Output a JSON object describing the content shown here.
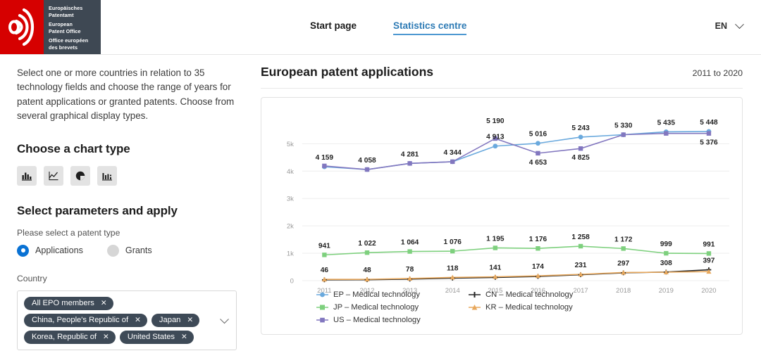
{
  "header": {
    "logo": {
      "lines": [
        "Europäisches\nPatentamt",
        "European\nPatent Office",
        "Office européen\ndes brevets"
      ],
      "line1a": "Europäisches",
      "line1b": "Patentamt",
      "line2a": "European",
      "line2b": "Patent Office",
      "line3a": "Office européen",
      "line3b": "des brevets"
    },
    "nav": [
      {
        "label": "Start page",
        "active": false
      },
      {
        "label": "Statistics centre",
        "active": true
      }
    ],
    "language": "EN"
  },
  "sidebar": {
    "intro": "Select one or more countries in relation to 35 technology fields and choose the range of years for patent applications or granted patents. Choose from several graphical display types.",
    "chart_type_heading": "Choose a chart type",
    "chart_types": [
      {
        "name": "bar-chart-icon",
        "label": "Bar chart"
      },
      {
        "name": "line-chart-icon",
        "label": "Line chart"
      },
      {
        "name": "pie-chart-icon",
        "label": "Pie chart"
      },
      {
        "name": "column-chart-icon",
        "label": "Column chart"
      }
    ],
    "parameters_heading": "Select parameters and apply",
    "patent_type_label": "Please select a patent type",
    "patent_types": [
      {
        "label": "Applications",
        "selected": true
      },
      {
        "label": "Grants",
        "selected": false
      }
    ],
    "country_label": "Country",
    "country_tags": [
      "All EPO members",
      "China, People's Republic of",
      "Japan",
      "Korea, Republic of",
      "United States"
    ],
    "remove_icon": "✕"
  },
  "chart_header": {
    "title": "European patent applications",
    "range": "2011 to 2020"
  },
  "chart_data": {
    "type": "line",
    "title": "European patent applications",
    "subtitle": "2011 to 2020",
    "xlabel": "",
    "ylabel": "",
    "x": [
      "2011",
      "2012",
      "2013",
      "2014",
      "2015",
      "2016",
      "2017",
      "2018",
      "2019",
      "2020"
    ],
    "categories": [
      "2011",
      "2012",
      "2013",
      "2014",
      "2015",
      "2016",
      "2017",
      "2018",
      "2019",
      "2020"
    ],
    "ylim": [
      0,
      5600
    ],
    "ytick_labels": [
      "0",
      "1k",
      "2k",
      "3k",
      "4k",
      "5k"
    ],
    "ytick_values": [
      0,
      1000,
      2000,
      3000,
      4000,
      5000
    ],
    "grid": true,
    "legend_position": "bottom",
    "series": [
      {
        "name": "EP – Medical technology",
        "color": "#6aa9dd",
        "marker": "circle",
        "values": [
          4159,
          4058,
          4281,
          4344,
          4913,
          5016,
          5243,
          5330,
          5435,
          5448
        ],
        "labels": [
          "4 159",
          "4 058",
          "4 281",
          "4 344",
          "4 913",
          "5 016",
          "5 243",
          "5 330",
          "5 435",
          "5 448"
        ]
      },
      {
        "name": "CN – Medical technology",
        "color": "#252525",
        "marker": "plus",
        "values": [
          30,
          34,
          55,
          92,
          118,
          152,
          215,
          285,
          312,
          397
        ],
        "labels": [
          "",
          "",
          "",
          "",
          "",
          "",
          "",
          "",
          "",
          "397"
        ]
      },
      {
        "name": "JP – Medical technology",
        "color": "#7ed07e",
        "marker": "square",
        "values": [
          941,
          1022,
          1064,
          1076,
          1195,
          1176,
          1258,
          1172,
          999,
          991
        ],
        "labels": [
          "941",
          "1 022",
          "1 064",
          "1 076",
          "1 195",
          "1 176",
          "1 258",
          "1 172",
          "999",
          "991"
        ]
      },
      {
        "name": "KR – Medical technology",
        "color": "#e8a85c",
        "marker": "triangle",
        "values": [
          46,
          48,
          78,
          118,
          141,
          174,
          231,
          297,
          308,
          330
        ],
        "labels": [
          "46",
          "48",
          "78",
          "118",
          "141",
          "174",
          "231",
          "297",
          "308",
          ""
        ]
      },
      {
        "name": "US – Medical technology",
        "color": "#8277bf",
        "marker": "square",
        "values": [
          4190,
          4058,
          4281,
          4344,
          5190,
          4653,
          4825,
          5330,
          5376,
          5376
        ],
        "labels": [
          "",
          "",
          "",
          "",
          "5 190",
          "4 653",
          "4 825",
          "",
          "",
          "5 376"
        ]
      }
    ],
    "annotations": {
      "top_labels_2015": [
        "5 190",
        "4 913"
      ],
      "top_labels_2016": [
        "5 016",
        "4 653"
      ],
      "top_labels_2017": [
        "5 243",
        "4 825"
      ],
      "top_labels_2018": [
        "5 330"
      ],
      "top_labels_2019": [
        "5 435"
      ],
      "top_labels_2020": [
        "5 376",
        "5 448"
      ]
    }
  }
}
